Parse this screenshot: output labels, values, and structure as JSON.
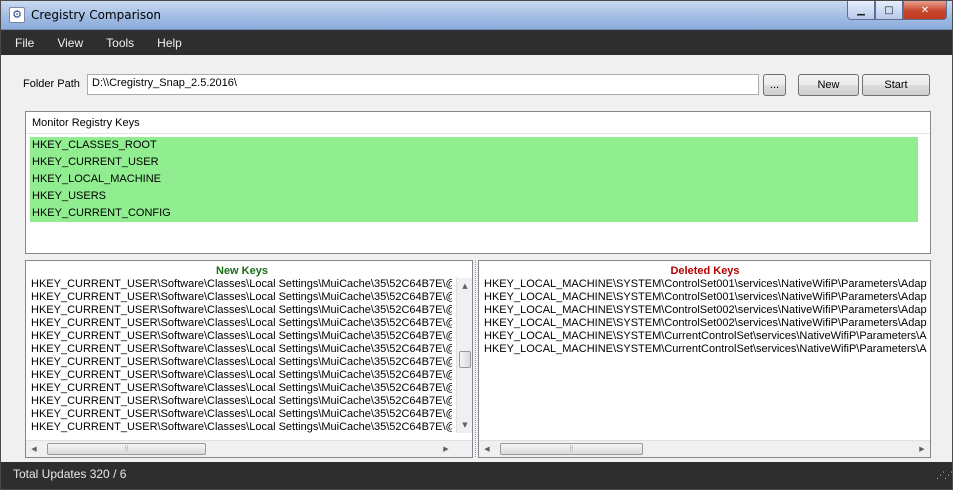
{
  "window": {
    "title": "Cregistry Comparison"
  },
  "menu": {
    "items": [
      "File",
      "View",
      "Tools",
      "Help"
    ]
  },
  "folder": {
    "label": "Folder Path",
    "value": "D:\\\\Cregistry_Snap_2.5.2016\\",
    "browse_label": "...",
    "new_label": "New",
    "start_label": "Start"
  },
  "monitor": {
    "header": "Monitor Registry Keys",
    "keys": [
      "HKEY_CLASSES_ROOT",
      "HKEY_CURRENT_USER",
      "HKEY_LOCAL_MACHINE",
      "HKEY_USERS",
      "HKEY_CURRENT_CONFIG"
    ],
    "highlight_color": "#90ee90"
  },
  "new_keys": {
    "title": "New Keys",
    "title_color": "#1a6b1a",
    "rows": [
      "HKEY_CURRENT_USER\\Software\\Classes\\Local Settings\\MuiCache\\35\\52C64B7E\\@",
      "HKEY_CURRENT_USER\\Software\\Classes\\Local Settings\\MuiCache\\35\\52C64B7E\\@",
      "HKEY_CURRENT_USER\\Software\\Classes\\Local Settings\\MuiCache\\35\\52C64B7E\\@",
      "HKEY_CURRENT_USER\\Software\\Classes\\Local Settings\\MuiCache\\35\\52C64B7E\\@",
      "HKEY_CURRENT_USER\\Software\\Classes\\Local Settings\\MuiCache\\35\\52C64B7E\\@",
      "HKEY_CURRENT_USER\\Software\\Classes\\Local Settings\\MuiCache\\35\\52C64B7E\\@",
      "HKEY_CURRENT_USER\\Software\\Classes\\Local Settings\\MuiCache\\35\\52C64B7E\\@",
      "HKEY_CURRENT_USER\\Software\\Classes\\Local Settings\\MuiCache\\35\\52C64B7E\\@",
      "HKEY_CURRENT_USER\\Software\\Classes\\Local Settings\\MuiCache\\35\\52C64B7E\\@",
      "HKEY_CURRENT_USER\\Software\\Classes\\Local Settings\\MuiCache\\35\\52C64B7E\\@",
      "HKEY_CURRENT_USER\\Software\\Classes\\Local Settings\\MuiCache\\35\\52C64B7E\\@",
      "HKEY_CURRENT_USER\\Software\\Classes\\Local Settings\\MuiCache\\35\\52C64B7E\\@"
    ]
  },
  "deleted_keys": {
    "title": "Deleted Keys",
    "title_color": "#b30000",
    "rows": [
      "HKEY_LOCAL_MACHINE\\SYSTEM\\ControlSet001\\services\\NativeWifiP\\Parameters\\Adapte",
      "HKEY_LOCAL_MACHINE\\SYSTEM\\ControlSet001\\services\\NativeWifiP\\Parameters\\Adapte",
      "HKEY_LOCAL_MACHINE\\SYSTEM\\ControlSet002\\services\\NativeWifiP\\Parameters\\Adapte",
      "HKEY_LOCAL_MACHINE\\SYSTEM\\ControlSet002\\services\\NativeWifiP\\Parameters\\Adapte",
      "HKEY_LOCAL_MACHINE\\SYSTEM\\CurrentControlSet\\services\\NativeWifiP\\Parameters\\Ad",
      "HKEY_LOCAL_MACHINE\\SYSTEM\\CurrentControlSet\\services\\NativeWifiP\\Parameters\\Ad"
    ]
  },
  "status": {
    "text": "Total Updates  320 / 6"
  },
  "icons": {
    "app": "registry-app-icon",
    "minimize": "minimize-icon",
    "maximize": "maximize-icon",
    "close": "close-icon"
  }
}
